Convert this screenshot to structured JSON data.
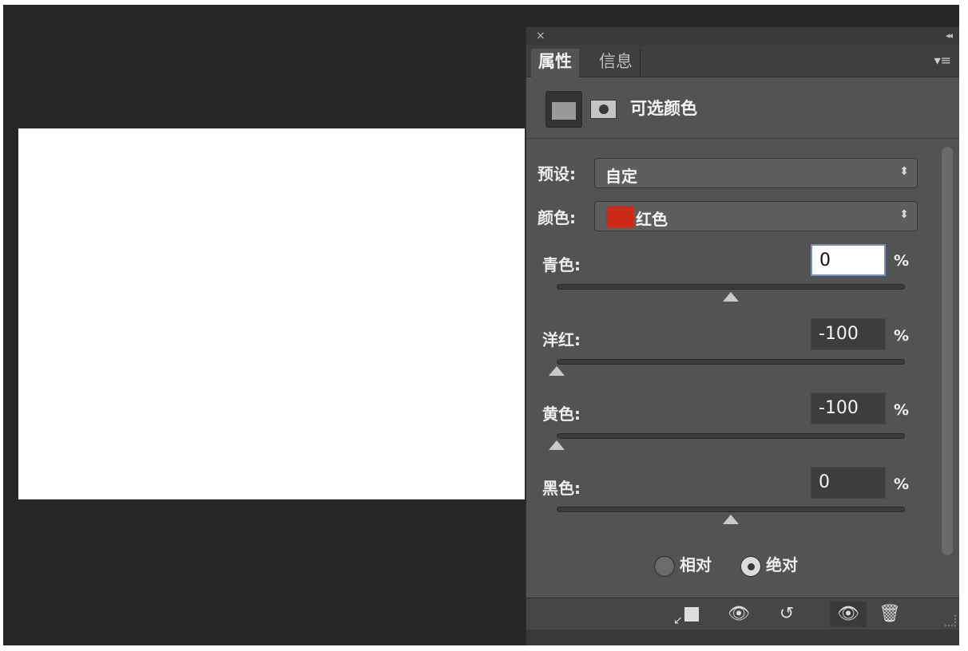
{
  "panel": {
    "close_glyph": "×",
    "collapse_glyph": "◂◂",
    "menu_glyph": "▾≡",
    "tabs": [
      {
        "label": "属性",
        "active": true
      },
      {
        "label": "信息",
        "active": false
      }
    ],
    "adjustment_title": "可选颜色"
  },
  "preset": {
    "label": "预设:",
    "value": "自定"
  },
  "colors": {
    "label": "颜色:",
    "value": "红色",
    "swatch": "#cc2a17"
  },
  "sliders": [
    {
      "label": "青色:",
      "value": "0",
      "unit": "%",
      "level": 0
    },
    {
      "label": "洋红:",
      "value": "-100",
      "unit": "%",
      "level": -100
    },
    {
      "label": "黄色:",
      "value": "-100",
      "unit": "%",
      "level": -100
    },
    {
      "label": "黑色:",
      "value": "0",
      "unit": "%",
      "level": 0
    }
  ],
  "method": {
    "relative": {
      "label": "相对",
      "selected": false
    },
    "absolute": {
      "label": "绝对",
      "selected": true
    }
  },
  "icons": {
    "select_arrows": "⬍",
    "view_prev": "👁",
    "reset": "↺",
    "visibility": "👁",
    "delete": "🗑"
  }
}
